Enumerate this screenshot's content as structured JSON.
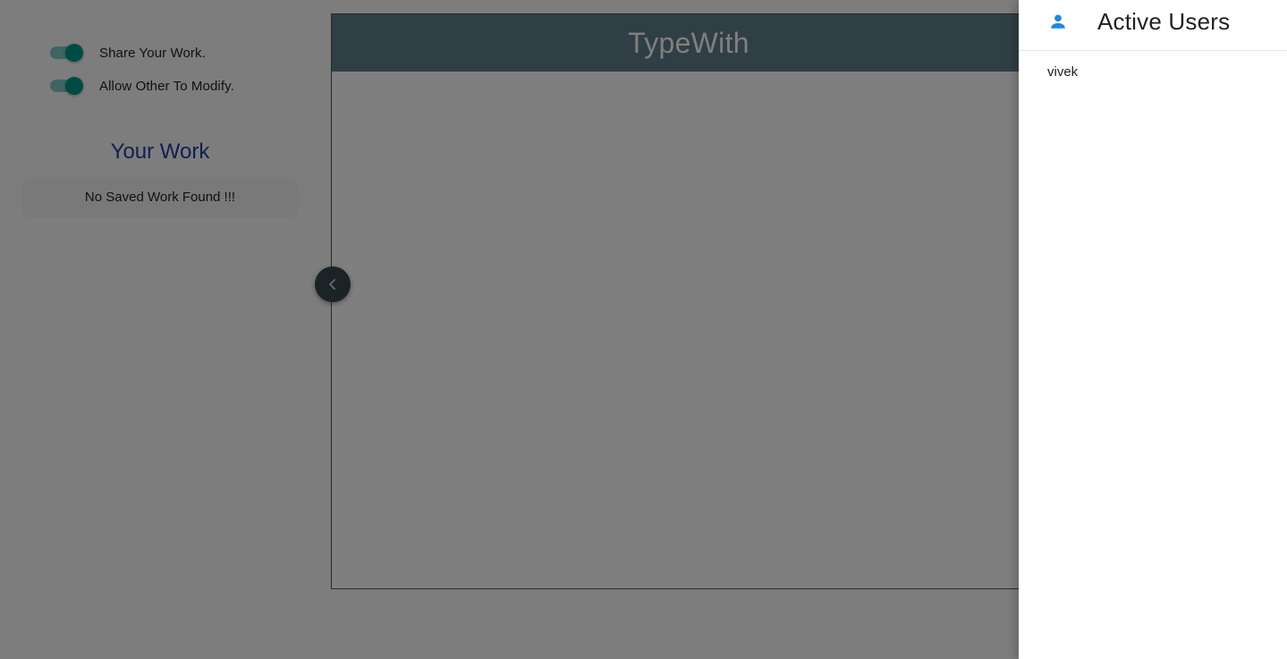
{
  "settings": {
    "share_label": "Share Your Work.",
    "share_enabled": true,
    "modify_label": "Allow Other To Modify.",
    "modify_enabled": true
  },
  "your_work": {
    "title": "Your Work",
    "empty_message": "No Saved Work Found !!!"
  },
  "editor": {
    "title": "TypeWith"
  },
  "drawer": {
    "title": "Active Users",
    "users": [
      "vivek"
    ]
  },
  "colors": {
    "accent_teal": "#00968a",
    "header_slate": "#607d8b",
    "work_title_blue": "#1f3fa8",
    "user_icon_blue": "#1e88e5"
  },
  "icons": {
    "collapse": "chevron-left-icon",
    "user": "person-icon"
  }
}
